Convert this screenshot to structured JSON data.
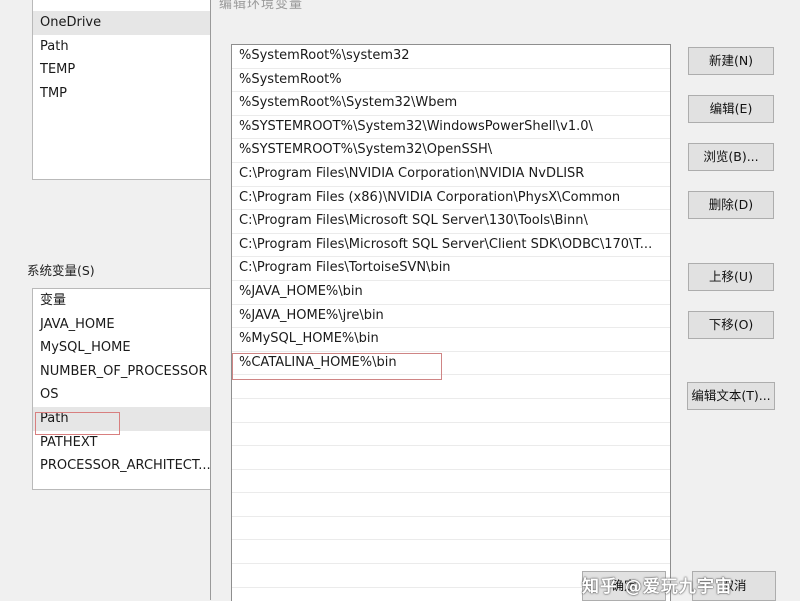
{
  "background_window": {
    "user_vars": {
      "items": [
        "OneDrive",
        "Path",
        "TEMP",
        "TMP"
      ]
    },
    "system_vars": {
      "label": "系统变量(S)",
      "items": [
        "变量",
        "JAVA_HOME",
        "MySQL_HOME",
        "NUMBER_OF_PROCESSOR",
        "OS",
        "Path",
        "PATHEXT",
        "PROCESSOR_ARCHITECT..."
      ]
    }
  },
  "dialog": {
    "title": "编辑环境变量",
    "entries": [
      "%SystemRoot%\\system32",
      "%SystemRoot%",
      "%SystemRoot%\\System32\\Wbem",
      "%SYSTEMROOT%\\System32\\WindowsPowerShell\\v1.0\\",
      "%SYSTEMROOT%\\System32\\OpenSSH\\",
      "C:\\Program Files\\NVIDIA Corporation\\NVIDIA NvDLISR",
      "C:\\Program Files (x86)\\NVIDIA Corporation\\PhysX\\Common",
      "C:\\Program Files\\Microsoft SQL Server\\130\\Tools\\Binn\\",
      "C:\\Program Files\\Microsoft SQL Server\\Client SDK\\ODBC\\170\\T...",
      "C:\\Program Files\\TortoiseSVN\\bin",
      "%JAVA_HOME%\\bin",
      "%JAVA_HOME%\\jre\\bin",
      "%MySQL_HOME%\\bin",
      "%CATALINA_HOME%\\bin"
    ],
    "buttons": {
      "new": "新建(N)",
      "edit": "编辑(E)",
      "browse": "浏览(B)...",
      "delete": "删除(D)",
      "move_up": "上移(U)",
      "move_down": "下移(O)",
      "edit_text": "编辑文本(T)...",
      "ok": "确定",
      "cancel": "取消"
    }
  },
  "watermark": "知乎 @爱玩九宇宙",
  "colors": {
    "highlight_border": "#d87f7f",
    "dialog_bg": "#f0f0f0",
    "button_bg": "#e1e1e1"
  }
}
